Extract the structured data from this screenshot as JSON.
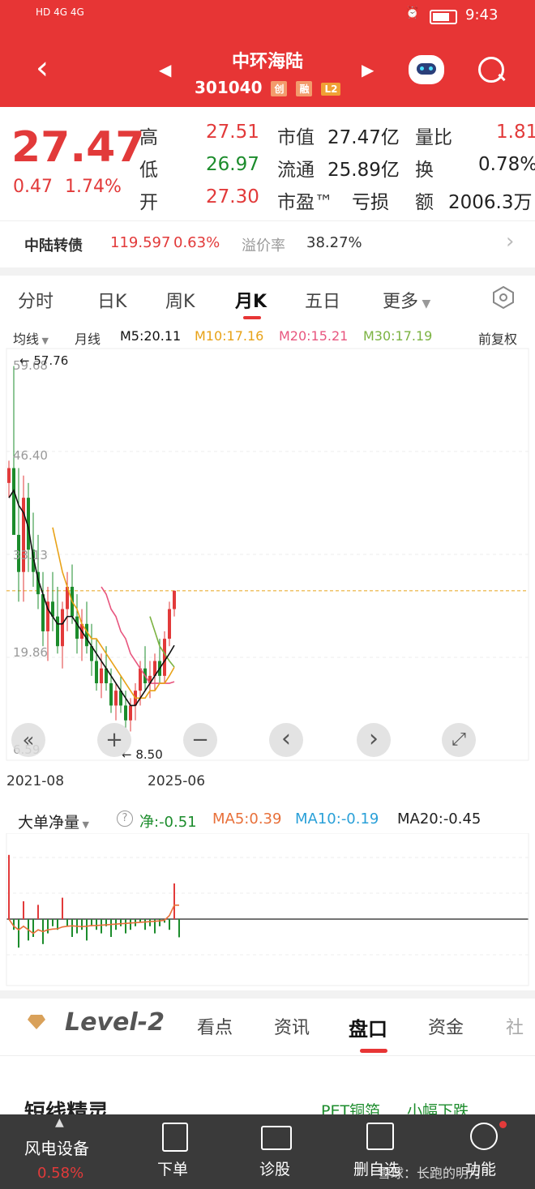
{
  "status": {
    "left_icons": "HD 4G 4G",
    "time": "9:43"
  },
  "header": {
    "title": "中环海陆",
    "code": "301040",
    "tags": [
      "创",
      "融",
      "L2"
    ]
  },
  "quote": {
    "price": "27.47",
    "change": "0.47",
    "change_pct": "1.74%",
    "high_label": "高",
    "high": "27.51",
    "low_label": "低",
    "low": "26.97",
    "open_label": "开",
    "open": "27.30",
    "mktcap_label": "市值",
    "mktcap": "27.47亿",
    "float_label": "流通",
    "float": "25.89亿",
    "pe_label": "市盈™",
    "pe": "亏损",
    "volratio_label": "量比",
    "volratio": "1.81",
    "turnover_label": "换",
    "turnover": "0.78%",
    "amount_label": "额",
    "amount": "2006.3万"
  },
  "bond": {
    "name": "中陆转债",
    "price": "119.597",
    "pct": "0.63%",
    "premium_label": "溢价率",
    "premium": "38.27%"
  },
  "tabs": [
    "分时",
    "日K",
    "周K",
    "月K",
    "五日",
    "更多"
  ],
  "active_tab": "月K",
  "ma_row": {
    "selector": "均线",
    "period": "月线",
    "m5": "M5:20.11",
    "m10": "M10:17.16",
    "m20": "M20:15.21",
    "m30": "M30:17.19",
    "adjust": "前复权"
  },
  "chart_labels": {
    "y_ticks": [
      "59.68",
      "46.40",
      "33.13",
      "19.86",
      "6.59"
    ],
    "high_mark": "57.76",
    "low_mark": "8.50",
    "x_start": "2021-08",
    "x_end": "2025-06"
  },
  "chart_controls": [
    "«",
    "+",
    "−",
    "‹",
    "›",
    "⤢"
  ],
  "flow": {
    "selector": "大单净量",
    "net": "净:-0.51",
    "ma5": "MA5:0.39",
    "ma10": "MA10:-0.19",
    "ma20": "MA20:-0.45"
  },
  "level2": {
    "brand": "Level-2",
    "tabs": [
      "看点",
      "资讯",
      "盘口",
      "资金",
      "社"
    ],
    "active": "盘口"
  },
  "below": {
    "heading": "短线精灵",
    "tag": "PET铜箔",
    "tag2": "小幅下跌"
  },
  "bottom": {
    "sector": "风电设备",
    "sector_pct": "0.58%",
    "items": [
      "下单",
      "诊股",
      "删自选",
      "功能"
    ],
    "watermark": "雪球：长跑的明月"
  },
  "colors": {
    "brand_red": "#e73535",
    "up": "#e23a3a",
    "down": "#1c8c2c",
    "ma5": "#111111",
    "ma10": "#e8a217",
    "ma20": "#e8567f",
    "ma30": "#7cb342"
  },
  "chart_data": {
    "type": "candlestick",
    "title": "",
    "x_range": [
      "2021-08",
      "2025-06"
    ],
    "ylim": [
      6.59,
      59.68
    ],
    "current_price": 27.47,
    "highest": 57.76,
    "lowest": 8.5,
    "ohlc": [
      [
        42,
        45,
        40,
        44
      ],
      [
        44,
        57.76,
        36,
        35
      ],
      [
        35,
        44,
        26,
        30
      ],
      [
        30,
        43,
        26,
        40
      ],
      [
        40,
        42,
        30,
        33
      ],
      [
        33,
        38,
        28,
        30
      ],
      [
        30,
        35,
        25,
        27
      ],
      [
        27,
        30,
        20,
        22
      ],
      [
        22,
        28,
        18,
        26
      ],
      [
        26,
        30,
        22,
        24
      ],
      [
        24,
        28,
        19,
        20
      ],
      [
        20,
        26,
        17,
        25
      ],
      [
        25,
        30,
        22,
        28
      ],
      [
        28,
        31,
        23,
        24
      ],
      [
        24,
        27,
        19,
        21
      ],
      [
        21,
        25,
        18,
        23
      ],
      [
        23,
        26,
        19,
        20
      ],
      [
        20,
        23,
        16,
        18
      ],
      [
        18,
        21,
        14,
        15
      ],
      [
        15,
        19,
        13,
        17
      ],
      [
        17,
        20,
        14,
        15
      ],
      [
        15,
        17,
        11,
        12
      ],
      [
        12,
        15,
        10,
        14
      ],
      [
        14,
        16,
        11,
        12
      ],
      [
        12,
        14,
        9,
        10
      ],
      [
        10,
        13,
        8.5,
        12
      ],
      [
        12,
        15,
        10,
        14
      ],
      [
        14,
        18,
        12,
        17
      ],
      [
        17,
        20,
        14,
        15
      ],
      [
        15,
        18,
        13,
        16
      ],
      [
        16,
        19,
        14,
        18
      ],
      [
        18,
        21,
        15,
        16
      ],
      [
        16,
        22,
        15,
        21
      ],
      [
        21,
        26,
        20,
        25
      ],
      [
        25,
        27.51,
        24,
        27.47
      ]
    ],
    "ma5": [
      40,
      41,
      39,
      38,
      36,
      32,
      29,
      27,
      25,
      24,
      23,
      23,
      24,
      24,
      23,
      22,
      21,
      20,
      19,
      18,
      17,
      16,
      15,
      14,
      13,
      12,
      12,
      13,
      14,
      15,
      16,
      17,
      18,
      19,
      20.11
    ],
    "ma10": [
      null,
      null,
      null,
      null,
      null,
      null,
      null,
      null,
      null,
      36,
      33,
      30,
      28,
      26,
      25,
      23,
      22,
      21,
      21,
      20,
      19,
      18,
      17,
      16,
      15,
      14,
      13,
      13,
      13,
      14,
      14,
      15,
      15,
      16,
      17.16
    ],
    "ma20": [
      null,
      null,
      null,
      null,
      null,
      null,
      null,
      null,
      null,
      null,
      null,
      null,
      null,
      null,
      null,
      null,
      null,
      null,
      null,
      28,
      27,
      25,
      24,
      22,
      21,
      19,
      18,
      17,
      16,
      15,
      15,
      15,
      15,
      15,
      15.21
    ],
    "ma30": [
      null,
      null,
      null,
      null,
      null,
      null,
      null,
      null,
      null,
      null,
      null,
      null,
      null,
      null,
      null,
      null,
      null,
      null,
      null,
      null,
      null,
      null,
      null,
      null,
      null,
      null,
      null,
      null,
      null,
      24,
      22,
      20,
      19,
      18,
      17.19
    ],
    "flow_values": [
      1.8,
      -0.3,
      -0.8,
      0.5,
      -0.6,
      -0.5,
      0.4,
      -0.7,
      -0.4,
      -0.2,
      -0.3,
      0.6,
      -0.2,
      -0.5,
      -0.4,
      -0.3,
      -0.6,
      -0.2,
      -0.3,
      -0.4,
      -0.2,
      -0.5,
      -0.3,
      -0.2,
      -0.4,
      -0.3,
      -0.2,
      -0.1,
      -0.3,
      -0.2,
      -0.4,
      -0.2,
      -0.1,
      -0.3,
      1.0,
      -0.51
    ],
    "flow_ma5": [
      0,
      -0.2,
      -0.3,
      -0.2,
      -0.3,
      -0.4,
      -0.3,
      -0.35,
      -0.3,
      -0.28,
      -0.27,
      -0.22,
      -0.2,
      -0.19,
      -0.2,
      -0.21,
      -0.2,
      -0.18,
      -0.18,
      -0.17,
      -0.16,
      -0.15,
      -0.14,
      -0.13,
      -0.12,
      -0.11,
      -0.1,
      -0.09,
      -0.08,
      -0.07,
      -0.06,
      -0.05,
      -0.03,
      0.1,
      0.39,
      0.39
    ]
  }
}
